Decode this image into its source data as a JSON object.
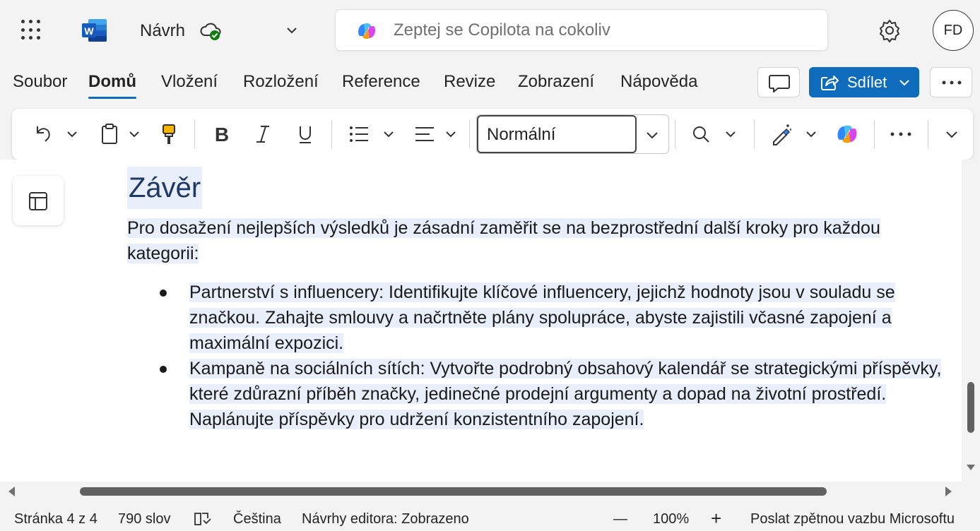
{
  "titlebar": {
    "doc_title": "Návrh",
    "search_placeholder": "Zeptej se Copilota na cokoliv",
    "avatar_initials": "FD",
    "icons": [
      "app-launcher-icon",
      "word-logo-icon",
      "cloud-saved-icon",
      "chevron-down-icon",
      "copilot-icon",
      "gear-icon"
    ]
  },
  "tabs": [
    {
      "label": "Soubor",
      "active": false
    },
    {
      "label": "Domů",
      "active": true
    },
    {
      "label": "Vložení",
      "active": false
    },
    {
      "label": "Rozložení",
      "active": false
    },
    {
      "label": "Reference",
      "active": false
    },
    {
      "label": "Revize",
      "active": false
    },
    {
      "label": "Zobrazení",
      "active": false
    },
    {
      "label": "Nápověda",
      "active": false
    }
  ],
  "header_actions": {
    "share_label": "Sdílet",
    "share_color": "#0f6cbd"
  },
  "toolbar": {
    "style_value": "Normální",
    "icons": [
      "undo-icon",
      "clipboard-icon",
      "format-painter-icon",
      "bold-icon",
      "italic-icon",
      "underline-icon",
      "bullets-icon",
      "align-icon",
      "search-icon",
      "editor-icon",
      "copilot-icon",
      "more-icon"
    ]
  },
  "document": {
    "heading": "Závěr",
    "paragraph": "Pro dosažení nejlepších výsledků je zásadní zaměřit se na bezprostřední další kroky pro každou kategorii:",
    "bullets": [
      "Partnerství s influencery: Identifikujte klíčové influencery, jejichž hodnoty jsou v souladu se značkou. Zahajte smlouvy a načrtněte plány spolupráce, abyste zajistili včasné zapojení a maximální expozici.",
      "Kampaně na sociálních sítích: Vytvořte podrobný obsahový kalendář se strategickými příspěvky, které zdůrazní příběh značky, jedinečné prodejní argumenty a dopad na životní prostředí. Naplánujte příspěvky pro udržení konzistentního zapojení."
    ],
    "heading_color": "#1f3864",
    "highlight_color": "#e8eefa"
  },
  "statusbar": {
    "page": "Stránka 4 z 4",
    "words": "790 slov",
    "language": "Čeština",
    "editor": "Návrhy editora: Zobrazeno",
    "zoom_minus": "—",
    "zoom": "100%",
    "zoom_plus": "+",
    "feedback": "Poslat zpětnou vazbu Microsoftu"
  }
}
